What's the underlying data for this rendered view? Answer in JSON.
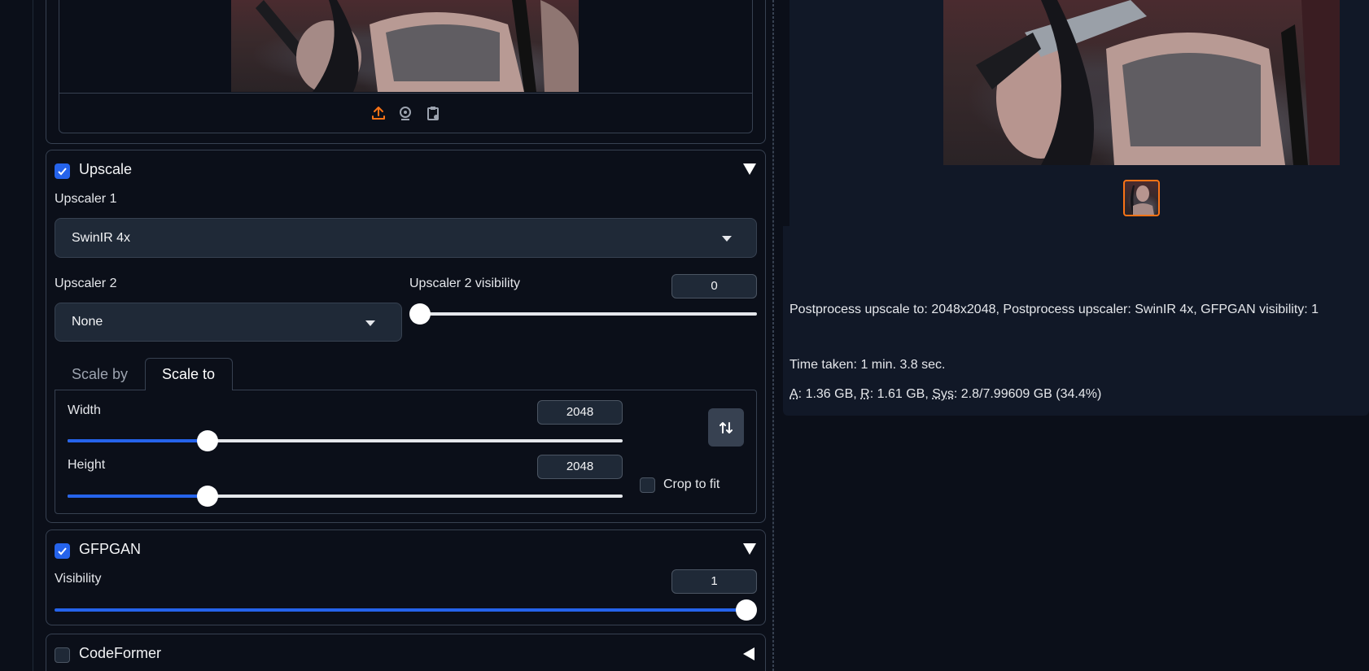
{
  "upscale": {
    "enabled": true,
    "title": "Upscale",
    "upscaler1": {
      "label": "Upscaler 1",
      "value": "SwinIR 4x"
    },
    "upscaler2": {
      "label": "Upscaler 2",
      "value": "None"
    },
    "upscaler2_visibility": {
      "label": "Upscaler 2 visibility",
      "value": "0",
      "fraction": 0
    },
    "tabs": [
      {
        "label": "Scale by",
        "active": false
      },
      {
        "label": "Scale to",
        "active": true
      }
    ],
    "width": {
      "label": "Width",
      "value": "2048",
      "fraction": 0.25
    },
    "height": {
      "label": "Height",
      "value": "2048",
      "fraction": 0.25
    },
    "crop_to_fit": {
      "label": "Crop to fit",
      "checked": false
    }
  },
  "gfpgan": {
    "enabled": true,
    "title": "GFPGAN",
    "visibility": {
      "label": "Visibility",
      "value": "1",
      "fraction": 1
    }
  },
  "codeformer": {
    "enabled": false,
    "title": "CodeFormer"
  },
  "output": {
    "info_line": "Postprocess upscale to: 2048x2048, Postprocess upscaler: SwinIR 4x, GFPGAN visibility: 1",
    "time_taken": "Time taken: 1 min. 3.8 sec.",
    "mem": {
      "a_label": "A",
      "a_value": ": 1.36 GB, ",
      "r_label": "R",
      "r_value": ": 1.61 GB, ",
      "sys_label": "Sys",
      "sys_value": ": 2.8/7.99609 GB (34.4%)"
    }
  },
  "icons": {
    "upload": "upload-icon",
    "webcam": "webcam-icon",
    "clipboard": "clipboard-icon",
    "swap": "swap-icon",
    "folder": "folder-icon",
    "image": "image-icon",
    "palette": "palette-icon",
    "ruler": "triangle-ruler-icon"
  },
  "colors": {
    "accent": "#2563eb",
    "background": "#0b0f19",
    "thumbnail_border": "#f97316"
  }
}
